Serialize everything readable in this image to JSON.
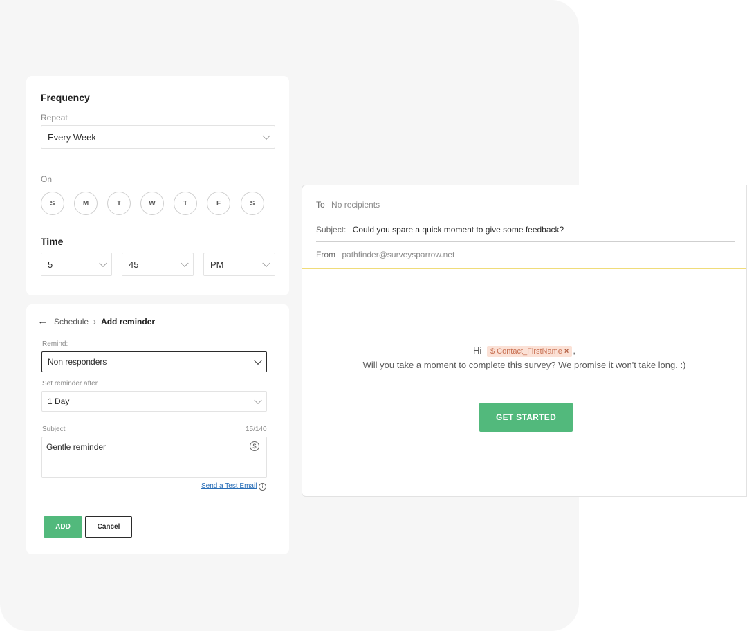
{
  "frequency": {
    "title": "Frequency",
    "repeat_label": "Repeat",
    "repeat_value": "Every Week",
    "on_label": "On",
    "days": [
      "S",
      "M",
      "T",
      "W",
      "T",
      "F",
      "S"
    ],
    "time_title": "Time",
    "hour": "5",
    "minute": "45",
    "ampm": "PM"
  },
  "reminder": {
    "breadcrumb_parent": "Schedule",
    "breadcrumb_current": "Add reminder",
    "remind_label": "Remind:",
    "remind_value": "Non responders",
    "after_label": "Set reminder after",
    "after_value": "1 Day",
    "subject_label": "Subject",
    "subject_count": "15/140",
    "subject_value": "Gentle reminder",
    "test_email_link": "Send a Test Email",
    "add_label": "ADD",
    "cancel_label": "Cancel"
  },
  "email": {
    "to_label": "To",
    "to_value": "No recipients",
    "subject_label": "Subject:",
    "subject_value": "Could you spare a quick moment to give some feedback?",
    "from_label": "From",
    "from_value": "pathfinder@surveysparrow.net",
    "greeting": "Hi",
    "placeholder_chip": "$ Contact_FirstName",
    "chip_remove": "×",
    "greeting_suffix": ",",
    "body": "Will you take a moment to complete this survey? We promise it won't take long. :)",
    "cta_label": "GET STARTED"
  },
  "colors": {
    "accent_green": "#52b97c",
    "chip_bg": "#fbe1d6",
    "divider_yellow": "#f0dc7a",
    "link_blue": "#2a6fb8"
  }
}
